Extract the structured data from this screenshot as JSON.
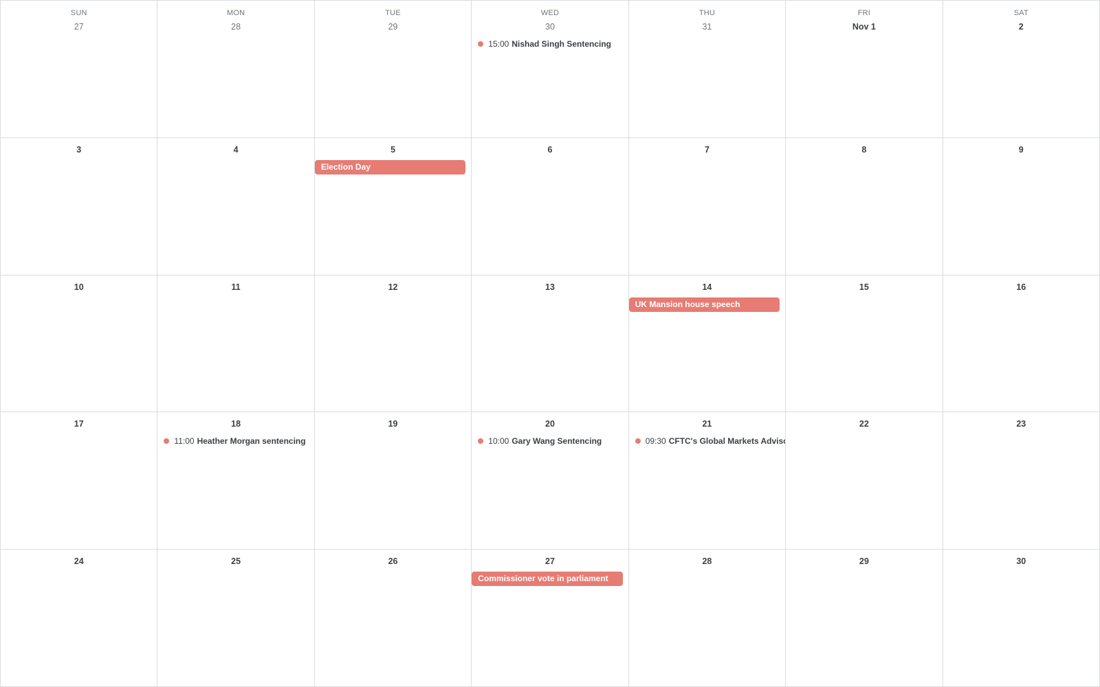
{
  "calendar": {
    "event_color": "#e67c73",
    "weekdays": [
      "SUN",
      "MON",
      "TUE",
      "WED",
      "THU",
      "FRI",
      "SAT"
    ],
    "weeks": [
      [
        {
          "date": "27",
          "other_month": true,
          "events": []
        },
        {
          "date": "28",
          "other_month": true,
          "events": []
        },
        {
          "date": "29",
          "other_month": true,
          "events": []
        },
        {
          "date": "30",
          "other_month": true,
          "events": [
            {
              "type": "timed",
              "time": "15:00",
              "title": "Nishad Singh Sentencing"
            }
          ]
        },
        {
          "date": "31",
          "other_month": true,
          "events": []
        },
        {
          "date": "Nov 1",
          "other_month": false,
          "month_start": true,
          "events": []
        },
        {
          "date": "2",
          "other_month": false,
          "events": []
        }
      ],
      [
        {
          "date": "3",
          "events": []
        },
        {
          "date": "4",
          "events": []
        },
        {
          "date": "5",
          "events": [
            {
              "type": "allday",
              "title": "Election Day"
            }
          ]
        },
        {
          "date": "6",
          "events": []
        },
        {
          "date": "7",
          "events": []
        },
        {
          "date": "8",
          "events": []
        },
        {
          "date": "9",
          "events": []
        }
      ],
      [
        {
          "date": "10",
          "events": []
        },
        {
          "date": "11",
          "events": []
        },
        {
          "date": "12",
          "events": []
        },
        {
          "date": "13",
          "events": []
        },
        {
          "date": "14",
          "events": [
            {
              "type": "allday",
              "title": "UK Mansion house speech"
            }
          ]
        },
        {
          "date": "15",
          "events": []
        },
        {
          "date": "16",
          "events": []
        }
      ],
      [
        {
          "date": "17",
          "events": []
        },
        {
          "date": "18",
          "events": [
            {
              "type": "timed",
              "time": "11:00",
              "title": "Heather Morgan sentencing"
            }
          ]
        },
        {
          "date": "19",
          "events": []
        },
        {
          "date": "20",
          "events": [
            {
              "type": "timed",
              "time": "10:00",
              "title": "Gary Wang Sentencing"
            }
          ]
        },
        {
          "date": "21",
          "events": [
            {
              "type": "timed",
              "time": "09:30",
              "title": "CFTC's Global Markets Advisory Committee"
            }
          ]
        },
        {
          "date": "22",
          "events": []
        },
        {
          "date": "23",
          "events": []
        }
      ],
      [
        {
          "date": "24",
          "events": []
        },
        {
          "date": "25",
          "events": []
        },
        {
          "date": "26",
          "events": []
        },
        {
          "date": "27",
          "events": [
            {
              "type": "allday",
              "title": "Commissioner vote in parliament"
            }
          ]
        },
        {
          "date": "28",
          "events": []
        },
        {
          "date": "29",
          "events": []
        },
        {
          "date": "30",
          "events": []
        }
      ]
    ]
  }
}
